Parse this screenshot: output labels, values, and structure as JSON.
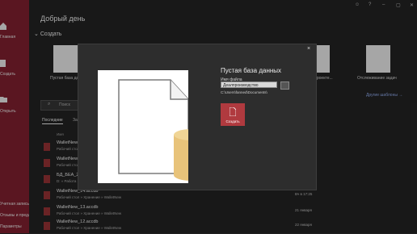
{
  "sidebar": {
    "items": [
      {
        "label": "Главная"
      },
      {
        "label": "Создать"
      },
      {
        "label": "Открыть"
      }
    ],
    "bottom": [
      {
        "label": "Учетная запись"
      },
      {
        "label": "Отзывы и предложения"
      },
      {
        "label": "Параметры"
      }
    ]
  },
  "main": {
    "greeting": "Добрый день",
    "create_header": "Создать",
    "templates": [
      {
        "label": "Пустая база дан..."
      },
      {
        "label": "...проекте..."
      },
      {
        "label": "Отслеживание задач"
      }
    ],
    "other_link": "Другие шаблоны  →",
    "search_placeholder": "Поиск",
    "tabs": {
      "recent": "Последние",
      "pinned": "За..."
    },
    "list_headers": {
      "name": "Имя",
      "modified": "...мена"
    },
    "files": [
      {
        "name": "WalletNew_...",
        "path": "Рабочий стол » ...",
        "date": ""
      },
      {
        "name": "WalletNew_...",
        "path": "Рабочий стол » ...",
        "date": ""
      },
      {
        "name": "БД_БЕА_202...",
        "path": "D: » Работа » ...",
        "date": ""
      },
      {
        "name": "WalletNew_14.accdb",
        "path": "Рабочий стол » Хранение » WalletNew",
        "date": "Вч в 17:25"
      },
      {
        "name": "WalletNew_13.accdb",
        "path": "Рабочий стол » Хранение » WalletNew",
        "date": "21 января"
      },
      {
        "name": "WalletNew_12.accdb",
        "path": "Рабочий стол » Хранение » WalletNew",
        "date": "22 января"
      }
    ]
  },
  "dialog": {
    "title": "Пустая база данных",
    "filename_label": "Имя файла",
    "filename_value": "Деалпроизводство",
    "path": "C:\\Users\\fanned\\Documents\\",
    "create_label": "Создать",
    "close_glyph": "×"
  },
  "titlebar": {
    "glyphs": [
      "☺",
      "?",
      "–",
      "▢",
      "✕"
    ]
  },
  "colors": {
    "accent": "#8b2333",
    "create_button": "#b03a3f",
    "db_cylinder": "#e8c37a"
  }
}
